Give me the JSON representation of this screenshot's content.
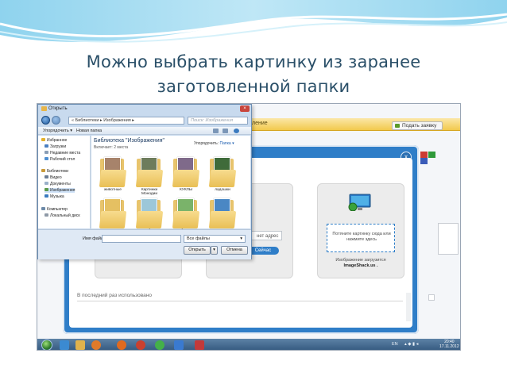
{
  "slide": {
    "title_line1": "Можно выбрать картинку из заранее",
    "title_line2": "заготовленной папки"
  },
  "browser": {
    "bar_text": "ление",
    "order_button": "Подать заявку"
  },
  "upload_dialog": {
    "close_label": "x",
    "url_card_note": "нет адрес",
    "url_card_button": "Сейчас",
    "dropzone_text": "Потяните картинку сюда или нажмите здесь",
    "zone_caption_line1": "Изображение загрузится",
    "zone_caption_line2": "ImageShack.us .",
    "last_used_label": "В последний раз использовано"
  },
  "open_dialog": {
    "title": "Открыть",
    "address_path": "« Библиотеки ▸ Изображения ▸",
    "search_placeholder": "Поиск: Изображения",
    "toolbar": {
      "organize": "Упорядочить ▾",
      "new_folder": "Новая папка"
    },
    "nav_items": [
      {
        "label": "Избранное",
        "icon": "star-icon",
        "color": "#e4b12d"
      },
      {
        "label": "Загрузки",
        "icon": "downloads-icon",
        "color": "#4a7fc1"
      },
      {
        "label": "Недавние места",
        "icon": "recent-icon",
        "color": "#8a9db5"
      },
      {
        "label": "Рабочий стол",
        "icon": "desktop-icon",
        "color": "#4f8fd1"
      },
      {
        "label": "Библиотеки",
        "icon": "library-icon",
        "color": "#c99a3a"
      },
      {
        "label": "Видео",
        "icon": "video-icon",
        "color": "#6a7d96"
      },
      {
        "label": "Документы",
        "icon": "documents-icon",
        "color": "#9ab0c9"
      },
      {
        "label": "Изображения",
        "icon": "images-icon",
        "color": "#5a9a4a"
      },
      {
        "label": "Музыка",
        "icon": "music-icon",
        "color": "#3a7bc0"
      },
      {
        "label": "Компьютер",
        "icon": "computer-icon",
        "color": "#6d8aa8"
      },
      {
        "label": "Локальный диск",
        "icon": "disk-icon",
        "color": "#8f9aa7"
      }
    ],
    "library_title": "Библиотека \"Изображения\"",
    "library_subtitle": "Включает: 2 места",
    "arrange_label": "Упорядочить:",
    "arrange_value": "Папка ▾",
    "folders": [
      {
        "label": "животные",
        "photo_color": "#a7836b"
      },
      {
        "label": "Картинки Монодии",
        "photo_color": "#6d7c5c"
      },
      {
        "label": "КУКЛЫ",
        "photo_color": "#7f6a8a"
      },
      {
        "label": "ладошки",
        "photo_color": "#3f6b3a"
      },
      {
        "label": "Новая папка",
        "photo_color": "#e5c062"
      },
      {
        "label": "обо",
        "photo_color": "#9cc7d9"
      },
      {
        "label": "Образцы",
        "photo_color": "#7ab36a"
      },
      {
        "label": "Природа",
        "photo_color": "#4a87c4"
      }
    ],
    "filename_label": "Имя файла:",
    "filetype_value": "Все файлы",
    "open_button": "Открыть",
    "cancel_button": "Отмена"
  },
  "taskbar": {
    "language": "EN",
    "time": "20:40",
    "date": "17.11.2012"
  }
}
